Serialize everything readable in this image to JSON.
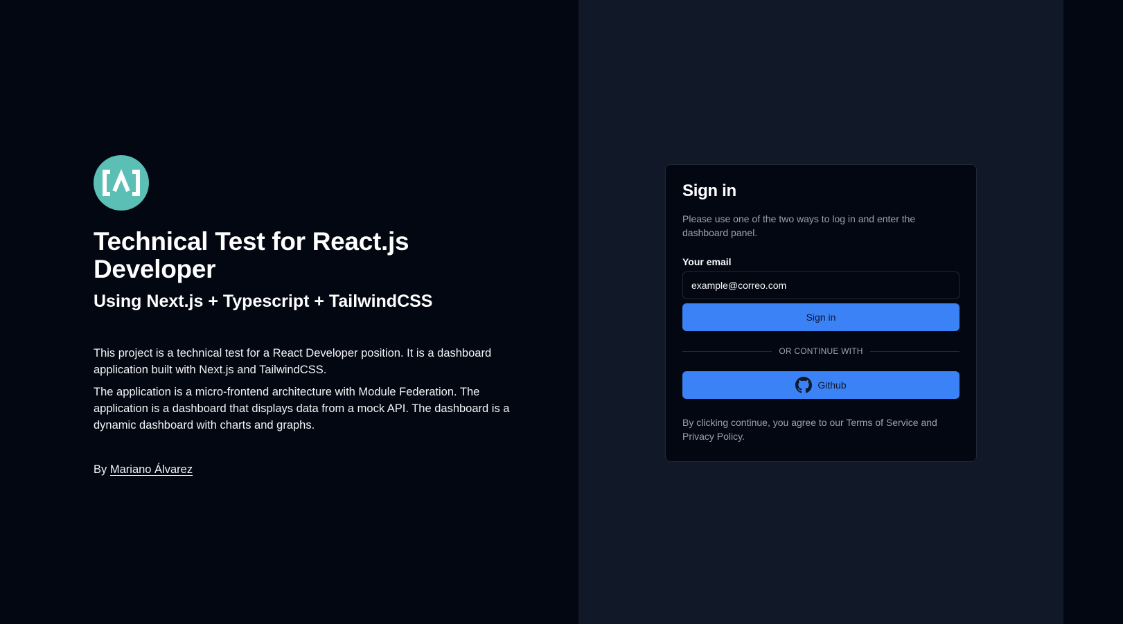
{
  "intro": {
    "logo_icon": "code-brackets-logo-icon",
    "title": "Technical Test for React.js Developer",
    "subtitle": "Using Next.js + Typescript + TailwindCSS",
    "paragraph1": "This project is a technical test for a React Developer position. It is a dashboard application built with Next.js and TailwindCSS.",
    "paragraph2": "The application is a micro-frontend architecture with Module Federation. The application is a dashboard that displays data from a mock API. The dashboard is a dynamic dashboard with charts and graphs.",
    "by_label": "By",
    "author_link": "Mariano Álvarez"
  },
  "signin": {
    "title": "Sign in",
    "hint": "Please use one of the two ways to log in and enter the dashboard panel.",
    "email_label": "Your email",
    "email_placeholder": "example@correo.com",
    "signin_button": "Sign in",
    "divider_text": "OR CONTINUE WITH",
    "github_button": "Github",
    "github_icon": "github-icon",
    "terms": "By clicking continue, you agree to our Terms of Service and Privacy Policy."
  },
  "colors": {
    "background_dark": "#030712",
    "panel_bg": "#111827",
    "accent_blue": "#3b82f6",
    "logo_teal": "#5bbfb5"
  }
}
